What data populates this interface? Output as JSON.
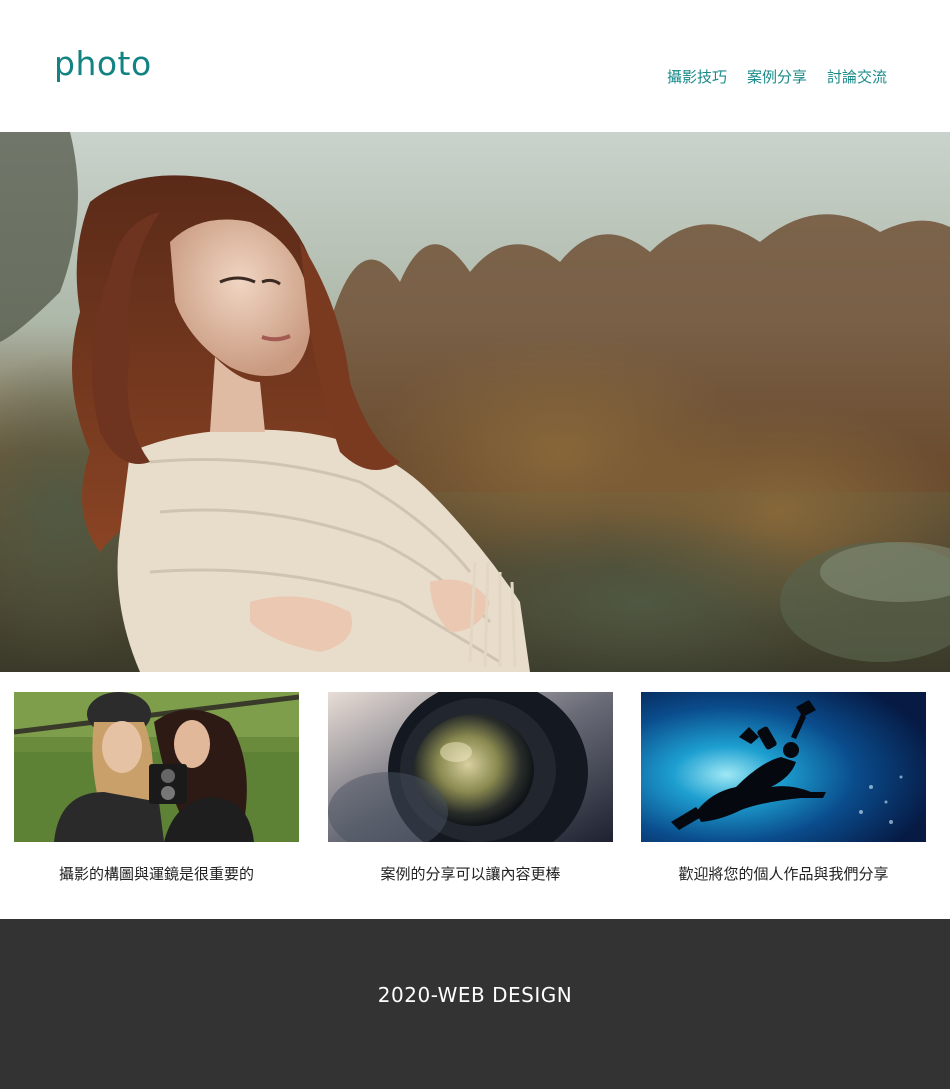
{
  "header": {
    "logo": "photo",
    "nav": [
      "攝影技巧",
      "案例分享",
      "討論交流"
    ]
  },
  "hero": {
    "image": "woman-in-lace-shawl-forest-photo"
  },
  "cards": [
    {
      "image": "two-friends-with-vintage-camera-photo",
      "caption": "攝影的構圖與運鏡是很重要的"
    },
    {
      "image": "camera-lens-closeup-photo",
      "caption": "案例的分享可以讓內容更棒"
    },
    {
      "image": "scuba-diver-silhouette-photo",
      "caption": "歡迎將您的個人作品與我們分享"
    }
  ],
  "footer": {
    "text": "2020-WEB DESIGN"
  },
  "colors": {
    "accent": "#128282",
    "footer_bg": "#333333"
  }
}
